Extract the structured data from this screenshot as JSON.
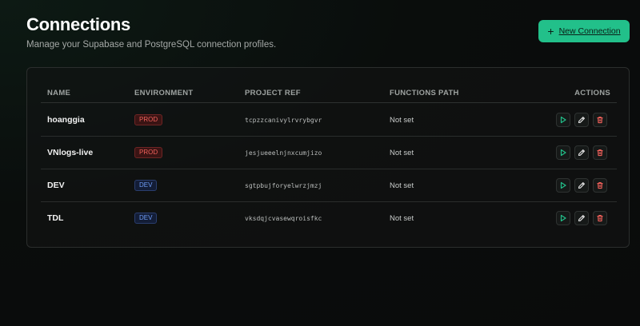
{
  "header": {
    "title": "Connections",
    "subtitle": "Manage your Supabase and PostgreSQL connection profiles.",
    "new_button_label": "New Connection",
    "new_button_icon": "plus-icon"
  },
  "table": {
    "columns": [
      "NAME",
      "ENVIRONMENT",
      "PROJECT REF",
      "FUNCTIONS PATH",
      "ACTIONS"
    ],
    "rows": [
      {
        "name": "hoanggia",
        "environment": "PROD",
        "project_ref": "tcpzzcanivylrvrybgvr",
        "functions_path": "Not set"
      },
      {
        "name": "VNlogs-live",
        "environment": "PROD",
        "project_ref": "jesjueeelnjnxcumjizo",
        "functions_path": "Not set"
      },
      {
        "name": "DEV",
        "environment": "DEV",
        "project_ref": "sgtpbujforyelwrzjmzj",
        "functions_path": "Not set"
      },
      {
        "name": "TDL",
        "environment": "DEV",
        "project_ref": "vksdqjcvasewqroisfkc",
        "functions_path": "Not set"
      }
    ],
    "action_icons": [
      "play-icon",
      "edit-icon",
      "trash-icon"
    ]
  },
  "colors": {
    "accent": "#22c08a",
    "prod": "#f0605a",
    "dev": "#6e9cf5",
    "play": "#22c08a",
    "edit": "#e6e6e6",
    "delete": "#f0605a"
  }
}
